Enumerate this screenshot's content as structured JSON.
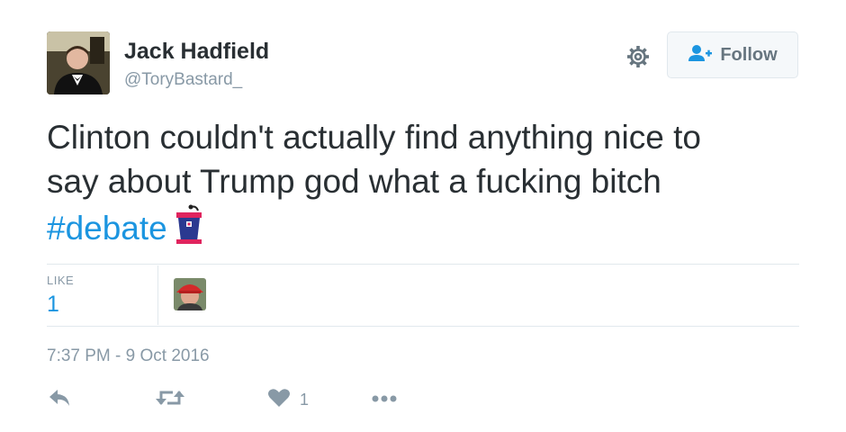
{
  "author": {
    "name": "Jack Hadfield",
    "handle": "@ToryBastard_"
  },
  "follow_button": {
    "label": "Follow"
  },
  "tweet": {
    "text_line1": "Clinton couldn't actually find anything nice to",
    "text_line2": "say about Trump god what a fucking bitch",
    "hashtag": "#debate",
    "emoji": "podium-icon"
  },
  "stats": {
    "likes_label": "LIKE",
    "likes_count": "1"
  },
  "timestamp": "7:37 PM - 9 Oct 2016",
  "actions": {
    "reply": "reply-icon",
    "retweet": "retweet-icon",
    "like": "heart-icon",
    "like_count": "1",
    "more": "more-icon"
  },
  "colors": {
    "link": "#1b95e0",
    "muted": "#8899a6",
    "text": "#292f33",
    "border": "#e1e8ed"
  }
}
